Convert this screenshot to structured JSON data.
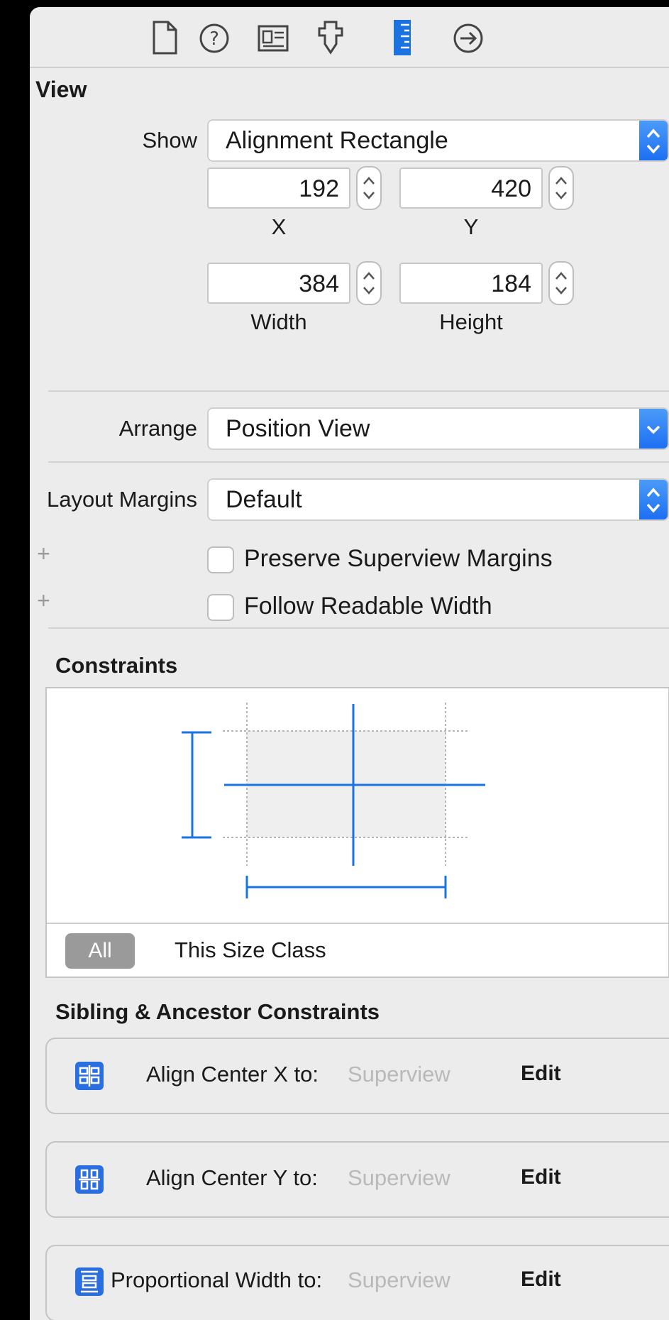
{
  "toolbar": {
    "icons": [
      "file-inspector-icon",
      "help-icon",
      "identity-inspector-icon",
      "attributes-inspector-icon",
      "size-inspector-icon",
      "connections-inspector-icon"
    ]
  },
  "section": {
    "title": "View"
  },
  "show": {
    "label": "Show",
    "value": "Alignment Rectangle"
  },
  "x": {
    "label": "X",
    "value": "192"
  },
  "y": {
    "label": "Y",
    "value": "420"
  },
  "width": {
    "label": "Width",
    "value": "384"
  },
  "height": {
    "label": "Height",
    "value": "184"
  },
  "arrange": {
    "label": "Arrange",
    "value": "Position View"
  },
  "layout_margins": {
    "label": "Layout Margins",
    "value": "Default"
  },
  "preserve": {
    "label": "Preserve Superview Margins",
    "plus": "+"
  },
  "readable": {
    "label": "Follow Readable Width",
    "plus": "+"
  },
  "constraints": {
    "title": "Constraints",
    "all": "All",
    "size_class": "This Size Class"
  },
  "sibling": {
    "title": "Sibling & Ancestor Constraints",
    "items": [
      {
        "label": "Align Center X to:",
        "target": "Superview",
        "edit": "Edit",
        "icon": "align-center-x-icon"
      },
      {
        "label": "Align Center Y to:",
        "target": "Superview",
        "edit": "Edit",
        "icon": "align-center-y-icon"
      },
      {
        "label": "Proportional Width to:",
        "target": "Superview",
        "edit": "Edit",
        "icon": "proportional-width-icon"
      }
    ]
  },
  "colors": {
    "accent": "#1a73e0",
    "panel": "#ececec",
    "background": "#000000"
  }
}
